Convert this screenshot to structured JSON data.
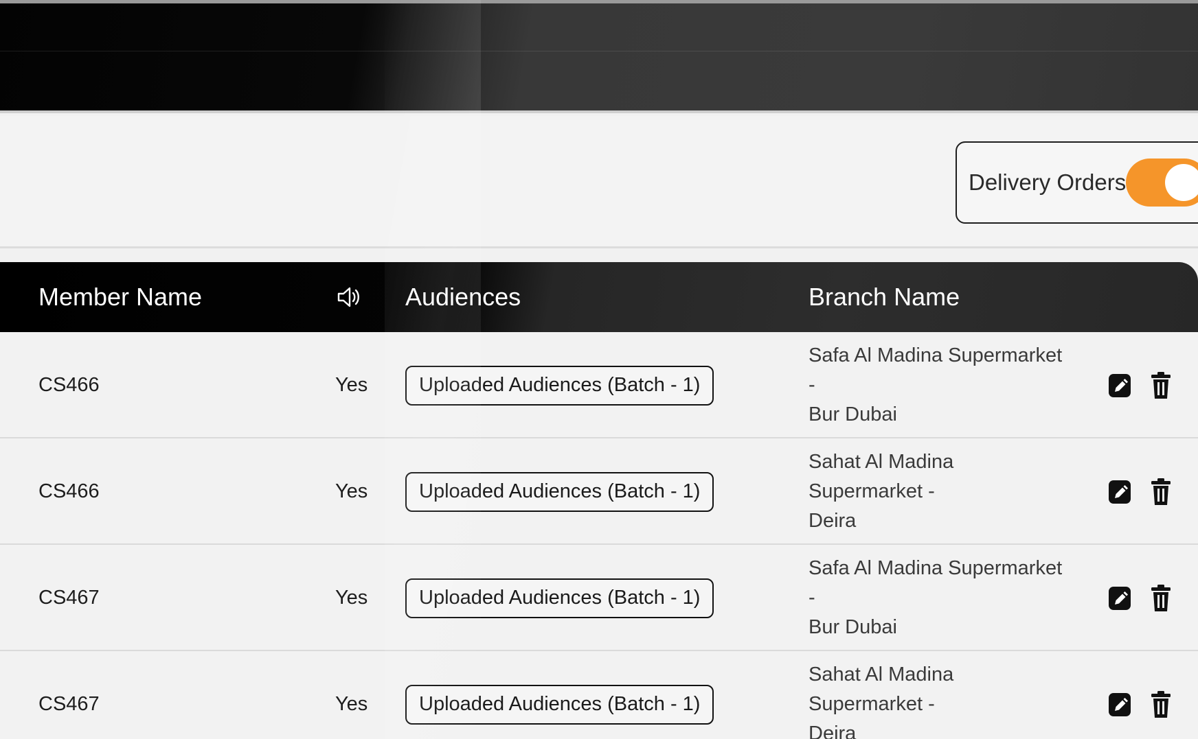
{
  "toolbar": {
    "delivery_toggle": {
      "label": "Delivery Orders",
      "enabled": true
    }
  },
  "table": {
    "columns": {
      "member_name": "Member Name",
      "announce_icon": "speaker-icon",
      "audiences": "Audiences",
      "branch_name": "Branch Name"
    },
    "rows": [
      {
        "member": "CS466",
        "announce": "Yes",
        "audience": "Uploaded Audiences (Batch - 1)",
        "branch_line1": "Safa Al Madina Supermarket -",
        "branch_line2": "Bur Dubai"
      },
      {
        "member": "CS466",
        "announce": "Yes",
        "audience": "Uploaded Audiences (Batch - 1)",
        "branch_line1": "Sahat Al Madina Supermarket -",
        "branch_line2": "Deira"
      },
      {
        "member": "CS467",
        "announce": "Yes",
        "audience": "Uploaded Audiences (Batch - 1)",
        "branch_line1": "Safa Al Madina Supermarket -",
        "branch_line2": "Bur Dubai"
      },
      {
        "member": "CS467",
        "announce": "Yes",
        "audience": "Uploaded Audiences (Batch - 1)",
        "branch_line1": "Sahat Al Madina Supermarket -",
        "branch_line2": "Deira"
      }
    ]
  },
  "colors": {
    "accent_toggle": "#f5952a",
    "header_bg": "#000000",
    "page_bg": "#f2f2f2"
  }
}
